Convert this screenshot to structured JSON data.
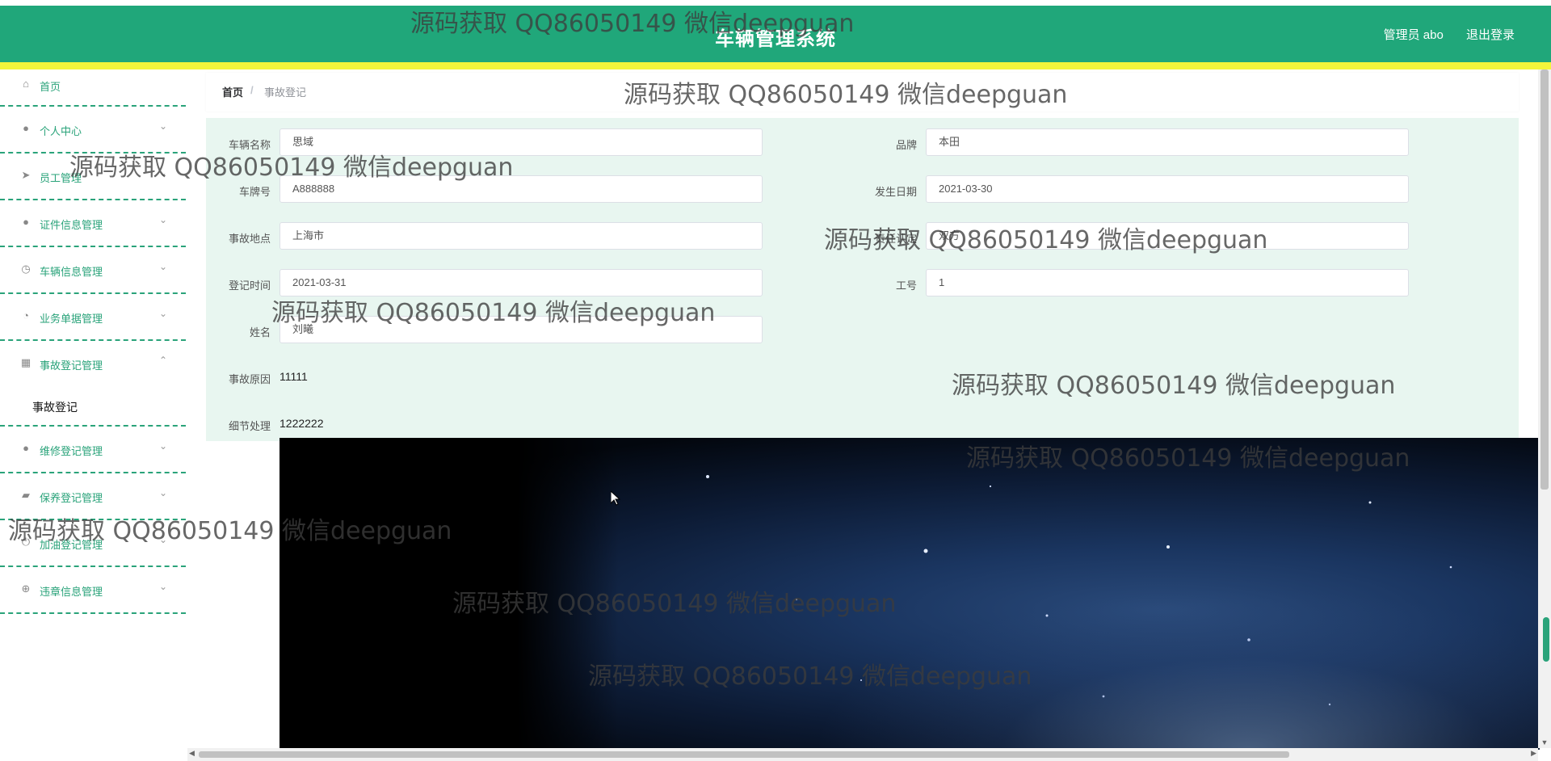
{
  "header": {
    "title": "车辆管理系统",
    "user_label": "管理员 abo",
    "logout_label": "退出登录",
    "color": "#20a77a",
    "accent_bar_color": "#f3f53b"
  },
  "sidebar": {
    "items": [
      {
        "label": "首页",
        "icon": "home-icon"
      },
      {
        "label": "个人中心",
        "icon": "user-icon"
      },
      {
        "label": "员工管理",
        "icon": "send-icon"
      },
      {
        "label": "证件信息管理",
        "icon": "user-icon"
      },
      {
        "label": "车辆信息管理",
        "icon": "clock-icon"
      },
      {
        "label": "业务单据管理",
        "icon": "gauge-icon"
      },
      {
        "label": "事故登记管理",
        "icon": "grid-icon",
        "expanded": true
      },
      {
        "label": "维修登记管理",
        "icon": "bulb-icon"
      },
      {
        "label": "保养登记管理",
        "icon": "wallet-icon"
      },
      {
        "label": "加油登记管理",
        "icon": "power-icon"
      },
      {
        "label": "违章信息管理",
        "icon": "compass-icon"
      }
    ],
    "submenu_label": "事故登记"
  },
  "breadcrumb": {
    "home": "首页",
    "separator": "/",
    "current": "事故登记"
  },
  "form": {
    "vehicle_name": {
      "label": "车辆名称",
      "value": "思域"
    },
    "brand": {
      "label": "品牌",
      "value": "本田"
    },
    "plate": {
      "label": "车牌号",
      "value": "A888888"
    },
    "date": {
      "label": "发生日期",
      "value": "2021-03-30"
    },
    "location": {
      "label": "事故地点",
      "value": "上海市"
    },
    "liability": {
      "label": "责任认定",
      "value": "双方"
    },
    "reg_time": {
      "label": "登记时间",
      "value": "2021-03-31"
    },
    "job_no": {
      "label": "工号",
      "value": "1"
    },
    "name": {
      "label": "姓名",
      "value": "刘曦"
    },
    "cause": {
      "label": "事故原因",
      "value": "11111"
    },
    "handling": {
      "label": "细节处理",
      "value": "1222222"
    }
  },
  "watermark_text": "源码获取 QQ86050149 微信deepguan"
}
